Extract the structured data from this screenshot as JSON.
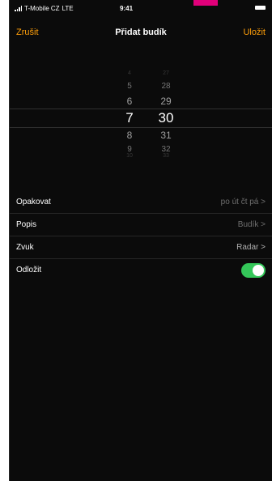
{
  "status_bar": {
    "carrier": "T-Mobile CZ",
    "network": "LTE",
    "time": "9:41"
  },
  "nav": {
    "cancel_label": "Zrušit",
    "title": "Přidat budík",
    "save_label": "Uložit"
  },
  "picker": {
    "hours": [
      "4",
      "5",
      "6",
      "7",
      "8",
      "9",
      "10"
    ],
    "minutes": [
      "27",
      "28",
      "29",
      "30",
      "31",
      "32",
      "33"
    ],
    "selected_hour": "7",
    "selected_minute": "30"
  },
  "settings": {
    "repeat": {
      "label": "Opakovat",
      "value": "po út čt pá >"
    },
    "label": {
      "label": "Popis",
      "value": "Budík >"
    },
    "sound": {
      "label": "Zvuk",
      "value": "Radar >"
    },
    "snooze": {
      "label": "Odložit",
      "enabled": true
    }
  },
  "colors": {
    "accent": "#ff9f0a",
    "toggle_on": "#34c759",
    "background": "#0b0b0b",
    "highlight": "#e1007a"
  }
}
